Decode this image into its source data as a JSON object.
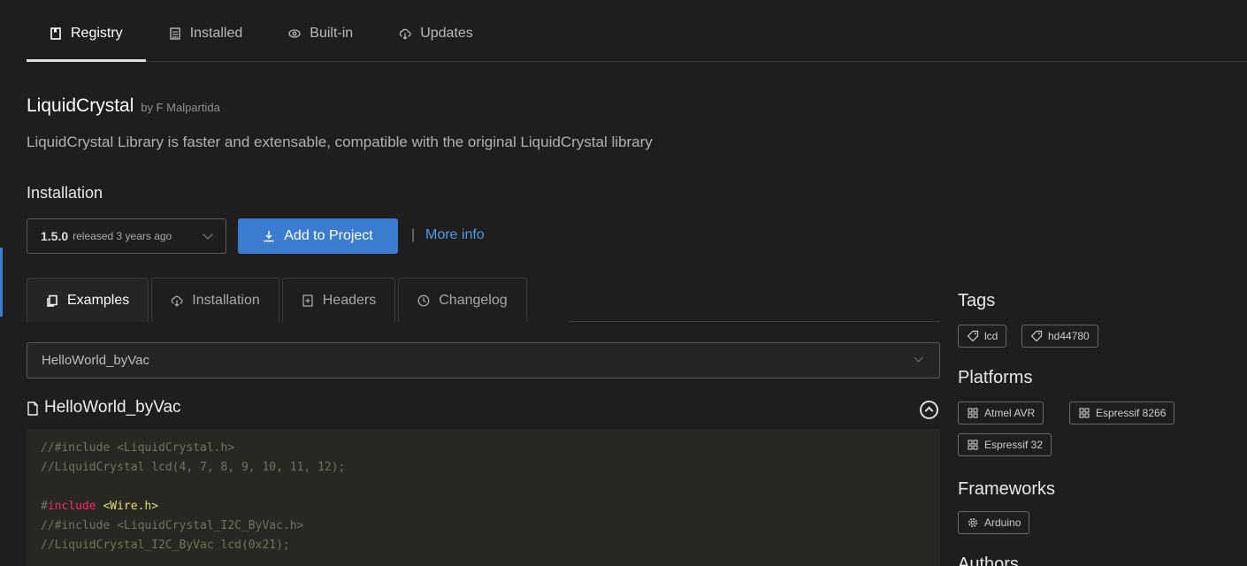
{
  "nav": {
    "tabs": [
      {
        "label": "Registry",
        "icon": "bookmark-icon",
        "active": true
      },
      {
        "label": "Installed",
        "icon": "list-icon",
        "active": false
      },
      {
        "label": "Built-in",
        "icon": "eye-icon",
        "active": false
      },
      {
        "label": "Updates",
        "icon": "cloud-download-icon",
        "active": false
      }
    ]
  },
  "library": {
    "name": "LiquidCrystal",
    "author": "by F Malpartida",
    "description": "LiquidCrystal Library is faster and extensable, compatible with the original LiquidCrystal library"
  },
  "installation": {
    "heading": "Installation",
    "version": "1.5.0",
    "released": "released 3 years ago",
    "add_button": "Add to Project",
    "separator": "|",
    "more_info": "More info"
  },
  "detail_tabs": [
    {
      "label": "Examples",
      "icon": "copy-icon",
      "active": true
    },
    {
      "label": "Installation",
      "icon": "cloud-download-icon",
      "active": false
    },
    {
      "label": "Headers",
      "icon": "file-plus-icon",
      "active": false
    },
    {
      "label": "Changelog",
      "icon": "clock-icon",
      "active": false
    }
  ],
  "example": {
    "selected": "HelloWorld_byVac",
    "title": "HelloWorld_byVac",
    "code": [
      [
        {
          "t": "//#include <LiquidCrystal.h>",
          "c": "cm"
        }
      ],
      [
        {
          "t": "//LiquidCrystal lcd(4, 7, 8, 9, 10, 11, 12);",
          "c": "cm"
        }
      ],
      [],
      [
        {
          "t": "#",
          "c": "cm"
        },
        {
          "t": "include",
          "c": "kw"
        },
        {
          "t": " ",
          "c": "cm"
        },
        {
          "t": "<Wire.h>",
          "c": "st"
        }
      ],
      [
        {
          "t": "//#include <LiquidCrystal_I2C_ByVac.h>",
          "c": "cm"
        }
      ],
      [
        {
          "t": "//LiquidCrystal_I2C_ByVac lcd(0x21);",
          "c": "cm"
        }
      ]
    ]
  },
  "sidebar": {
    "tags_heading": "Tags",
    "tags": [
      "lcd",
      "hd44780"
    ],
    "platforms_heading": "Platforms",
    "platforms": [
      "Atmel AVR",
      "Espressif 8266",
      "Espressif 32"
    ],
    "frameworks_heading": "Frameworks",
    "frameworks": [
      "Arduino"
    ],
    "authors_heading": "Authors"
  },
  "colors": {
    "background": "#1e1e1e",
    "accent": "#3a7ccf",
    "link": "#4d9be6",
    "code_background": "#272822"
  }
}
